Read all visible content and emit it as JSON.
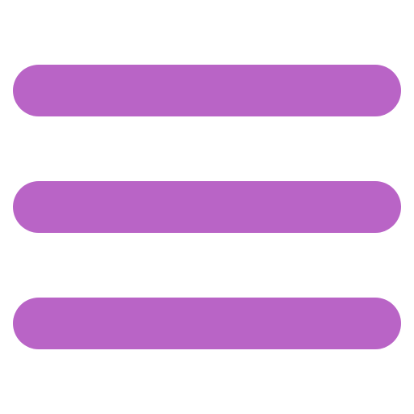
{
  "icon": {
    "name": "hamburger-menu-icon",
    "bar_count": 3,
    "color": "#B964C6",
    "background": "#FFFFFF"
  }
}
